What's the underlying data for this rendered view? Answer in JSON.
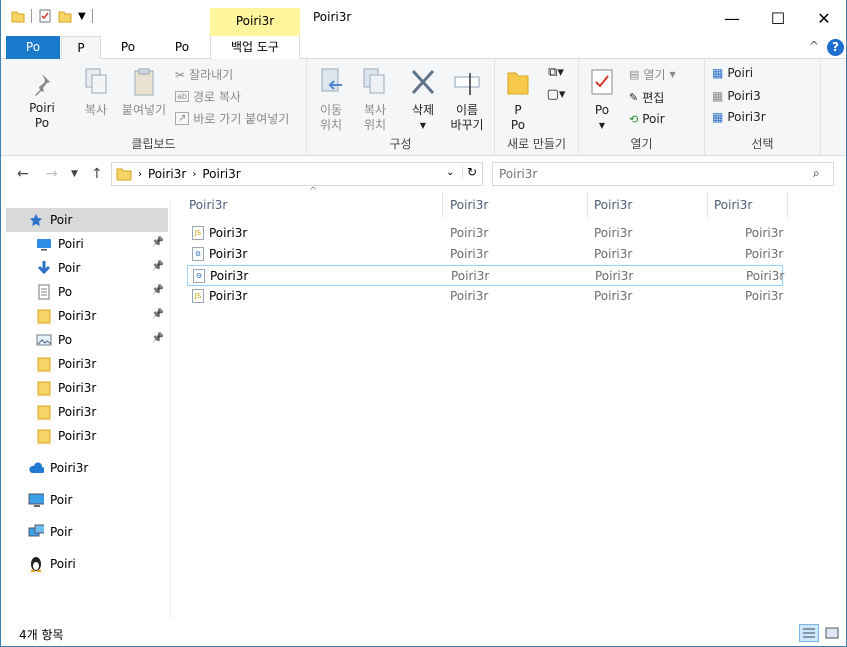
{
  "window": {
    "title": "Poiri3r",
    "context_tab_header": "Poiri3r",
    "controls": {
      "minimize": "—",
      "maximize": "☐",
      "close": "✕"
    }
  },
  "tabs": {
    "file": "Po",
    "active": "P",
    "tab3": "Po",
    "tab4": "Po",
    "context": "백업 도구",
    "expand_glyph": "^"
  },
  "ribbon": {
    "clipboard": {
      "label": "클립보드",
      "pin": "Poiri\nPo",
      "copy": "복사",
      "paste": "붙여넣기",
      "cut": "잘라내기",
      "copy_path": "경로 복사",
      "paste_shortcut": "바로 가기 붙여넣기"
    },
    "organize": {
      "label": "구성",
      "move_to": "이동\n위치",
      "copy_to": "복사\n위치",
      "delete": "삭제",
      "rename": "이름\n바꾸기"
    },
    "new": {
      "label": "새로 만들기",
      "new_folder": "P\nPo"
    },
    "open": {
      "label": "열기",
      "properties": "Po",
      "open": "열기",
      "edit": "편집",
      "history": "Poir"
    },
    "select": {
      "label": "선택",
      "select_all": "Poiri",
      "select_none": "Poiri3",
      "invert": "Poiri3r"
    }
  },
  "address": {
    "path": [
      "Poiri3r",
      "Poiri3r"
    ],
    "search_placeholder": "Poiri3r"
  },
  "nav_pane": [
    {
      "label": "Poir",
      "icon": "star-icon",
      "pinned": false,
      "selected": true
    },
    {
      "label": "Poiri",
      "icon": "desktop-icon",
      "pinned": true
    },
    {
      "label": "Poir",
      "icon": "download-icon",
      "pinned": true
    },
    {
      "label": "Po",
      "icon": "document-icon",
      "pinned": true
    },
    {
      "label": "Poiri3r",
      "icon": "folder-icon",
      "pinned": true
    },
    {
      "label": "Po",
      "icon": "picture-icon",
      "pinned": true
    },
    {
      "label": "Poiri3r",
      "icon": "folder-icon",
      "pinned": false
    },
    {
      "label": "Poiri3r",
      "icon": "folder-icon",
      "pinned": false
    },
    {
      "label": "Poiri3r",
      "icon": "folder-icon",
      "pinned": false
    },
    {
      "label": "Poiri3r",
      "icon": "folder-icon",
      "pinned": false
    },
    {
      "label": "Poiri3r",
      "icon": "cloud-icon",
      "pinned": false
    },
    {
      "label": "Poir",
      "icon": "computer-icon",
      "pinned": false
    },
    {
      "label": "Poir",
      "icon": "network-icon",
      "pinned": false
    },
    {
      "label": "Poiri",
      "icon": "linux-icon",
      "pinned": false
    }
  ],
  "columns": [
    "Poiri3r",
    "Poiri3r",
    "Poiri3r",
    "Poiri3r"
  ],
  "sort_indicator": "^",
  "files": [
    {
      "name": "Poiri3r",
      "date": "Poiri3r",
      "type": "Poiri3r",
      "size": "Poiri3r",
      "icon": "js-file-icon",
      "selected": false
    },
    {
      "name": "Poiri3r",
      "date": "Poiri3r",
      "type": "Poiri3r",
      "size": "Poiri3r",
      "icon": "settings-file-icon",
      "selected": false
    },
    {
      "name": "Poiri3r",
      "date": "Poiri3r",
      "type": "Poiri3r",
      "size": "Poiri3r",
      "icon": "settings-file-icon",
      "selected": true
    },
    {
      "name": "Poiri3r",
      "date": "Poiri3r",
      "type": "Poiri3r",
      "size": "Poiri3r",
      "icon": "js-file-icon",
      "selected": false
    }
  ],
  "status": {
    "item_count": "4개 항목"
  }
}
